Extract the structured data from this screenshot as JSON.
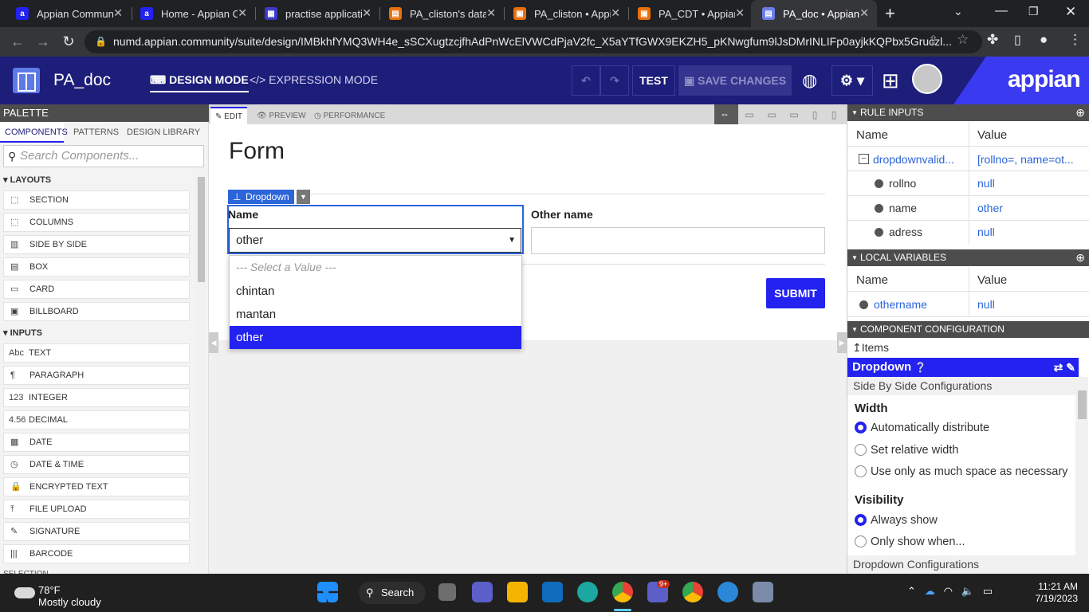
{
  "browser": {
    "tabs": [
      {
        "label": "Appian Commun",
        "favicon_color": "#2322f0",
        "favicon_letter": "a"
      },
      {
        "label": "Home - Appian C",
        "favicon_color": "#2322f0",
        "favicon_letter": "a"
      },
      {
        "label": "practise applicati",
        "favicon_color": "#3b3bc9",
        "favicon_letter": "▦"
      },
      {
        "label": "PA_cliston's data",
        "favicon_color": "#e8700a",
        "favicon_letter": "▤"
      },
      {
        "label": "PA_cliston • Appi",
        "favicon_color": "#e8700a",
        "favicon_letter": "▣"
      },
      {
        "label": "PA_CDT • Appian",
        "favicon_color": "#e8700a",
        "favicon_letter": "▣"
      },
      {
        "label": "PA_doc • Appian",
        "favicon_color": "#6b7ee8",
        "favicon_letter": "▤"
      }
    ],
    "url": "numd.appian.community/suite/design/IMBkhfYMQ3WH4e_sSCXugtzcjfhAdPnWcElVWCdPjaV2fc_X5aYTfGWX9EKZH5_pKNwgfum9lJsDMrINLIFp0ayjkKQPbx5Gruczl..."
  },
  "header": {
    "title": "PA_doc",
    "design_mode": "DESIGN MODE",
    "expression_mode": "EXPRESSION MODE",
    "test": "TEST",
    "save": "SAVE CHANGES",
    "brand": "appian"
  },
  "palette": {
    "title": "PALETTE",
    "tabs": [
      "COMPONENTS",
      "PATTERNS",
      "DESIGN LIBRARY"
    ],
    "search_placeholder": "Search Components...",
    "layouts_label": "LAYOUTS",
    "layouts": [
      "SECTION",
      "COLUMNS",
      "SIDE BY SIDE",
      "BOX",
      "CARD",
      "BILLBOARD"
    ],
    "inputs_label": "INPUTS",
    "inputs": [
      "TEXT",
      "PARAGRAPH",
      "INTEGER",
      "DECIMAL",
      "DATE",
      "DATE & TIME",
      "ENCRYPTED TEXT",
      "FILE UPLOAD",
      "SIGNATURE",
      "BARCODE"
    ],
    "input_prefixes": [
      "Abc",
      "¶",
      "123",
      "4.56",
      "▦",
      "◷",
      "🔒",
      "⤒",
      "✎",
      "|||"
    ],
    "next_section": "SELECTION"
  },
  "editor": {
    "tabs": [
      "EDIT",
      "PREVIEW",
      "PERFORMANCE"
    ],
    "form_title": "Form",
    "badge": "Dropdown",
    "name_label": "Name",
    "name_value": "other",
    "other_label": "Other name",
    "submit": "SUBMIT",
    "dropdown_options": [
      "--- Select a Value ---",
      "chintan",
      "mantan",
      "other"
    ],
    "selected_option": "other"
  },
  "rule_inputs": {
    "title": "RULE INPUTS",
    "col_name": "Name",
    "col_value": "Value",
    "parent_name": "dropdownvalid...",
    "parent_value": "[rollno=, name=ot...",
    "rows": [
      {
        "name": "rollno",
        "value": "null"
      },
      {
        "name": "name",
        "value": "other"
      },
      {
        "name": "adress",
        "value": "null"
      }
    ]
  },
  "local_variables": {
    "title": "LOCAL VARIABLES",
    "col_name": "Name",
    "col_value": "Value",
    "rows": [
      {
        "name": "othername",
        "value": "null"
      }
    ]
  },
  "component_config": {
    "title": "COMPONENT CONFIGURATION",
    "items": "Items",
    "component": "Dropdown",
    "subsection": "Side By Side Configurations",
    "width_label": "Width",
    "width_options": [
      "Automatically distribute",
      "Set relative width",
      "Use only as much space as necessary"
    ],
    "width_selected": 0,
    "visibility_label": "Visibility",
    "visibility_options": [
      "Always show",
      "Only show when..."
    ],
    "visibility_selected": 0,
    "next_section": "Dropdown Configurations"
  },
  "taskbar": {
    "temp": "78°F",
    "weather": "Mostly cloudy",
    "search": "Search",
    "teams_badge": "9+",
    "time": "11:21 AM",
    "date": "7/19/2023"
  },
  "colors": {
    "header": "#1d1d7a",
    "accent": "#2322f0",
    "link": "#2b65d9"
  }
}
